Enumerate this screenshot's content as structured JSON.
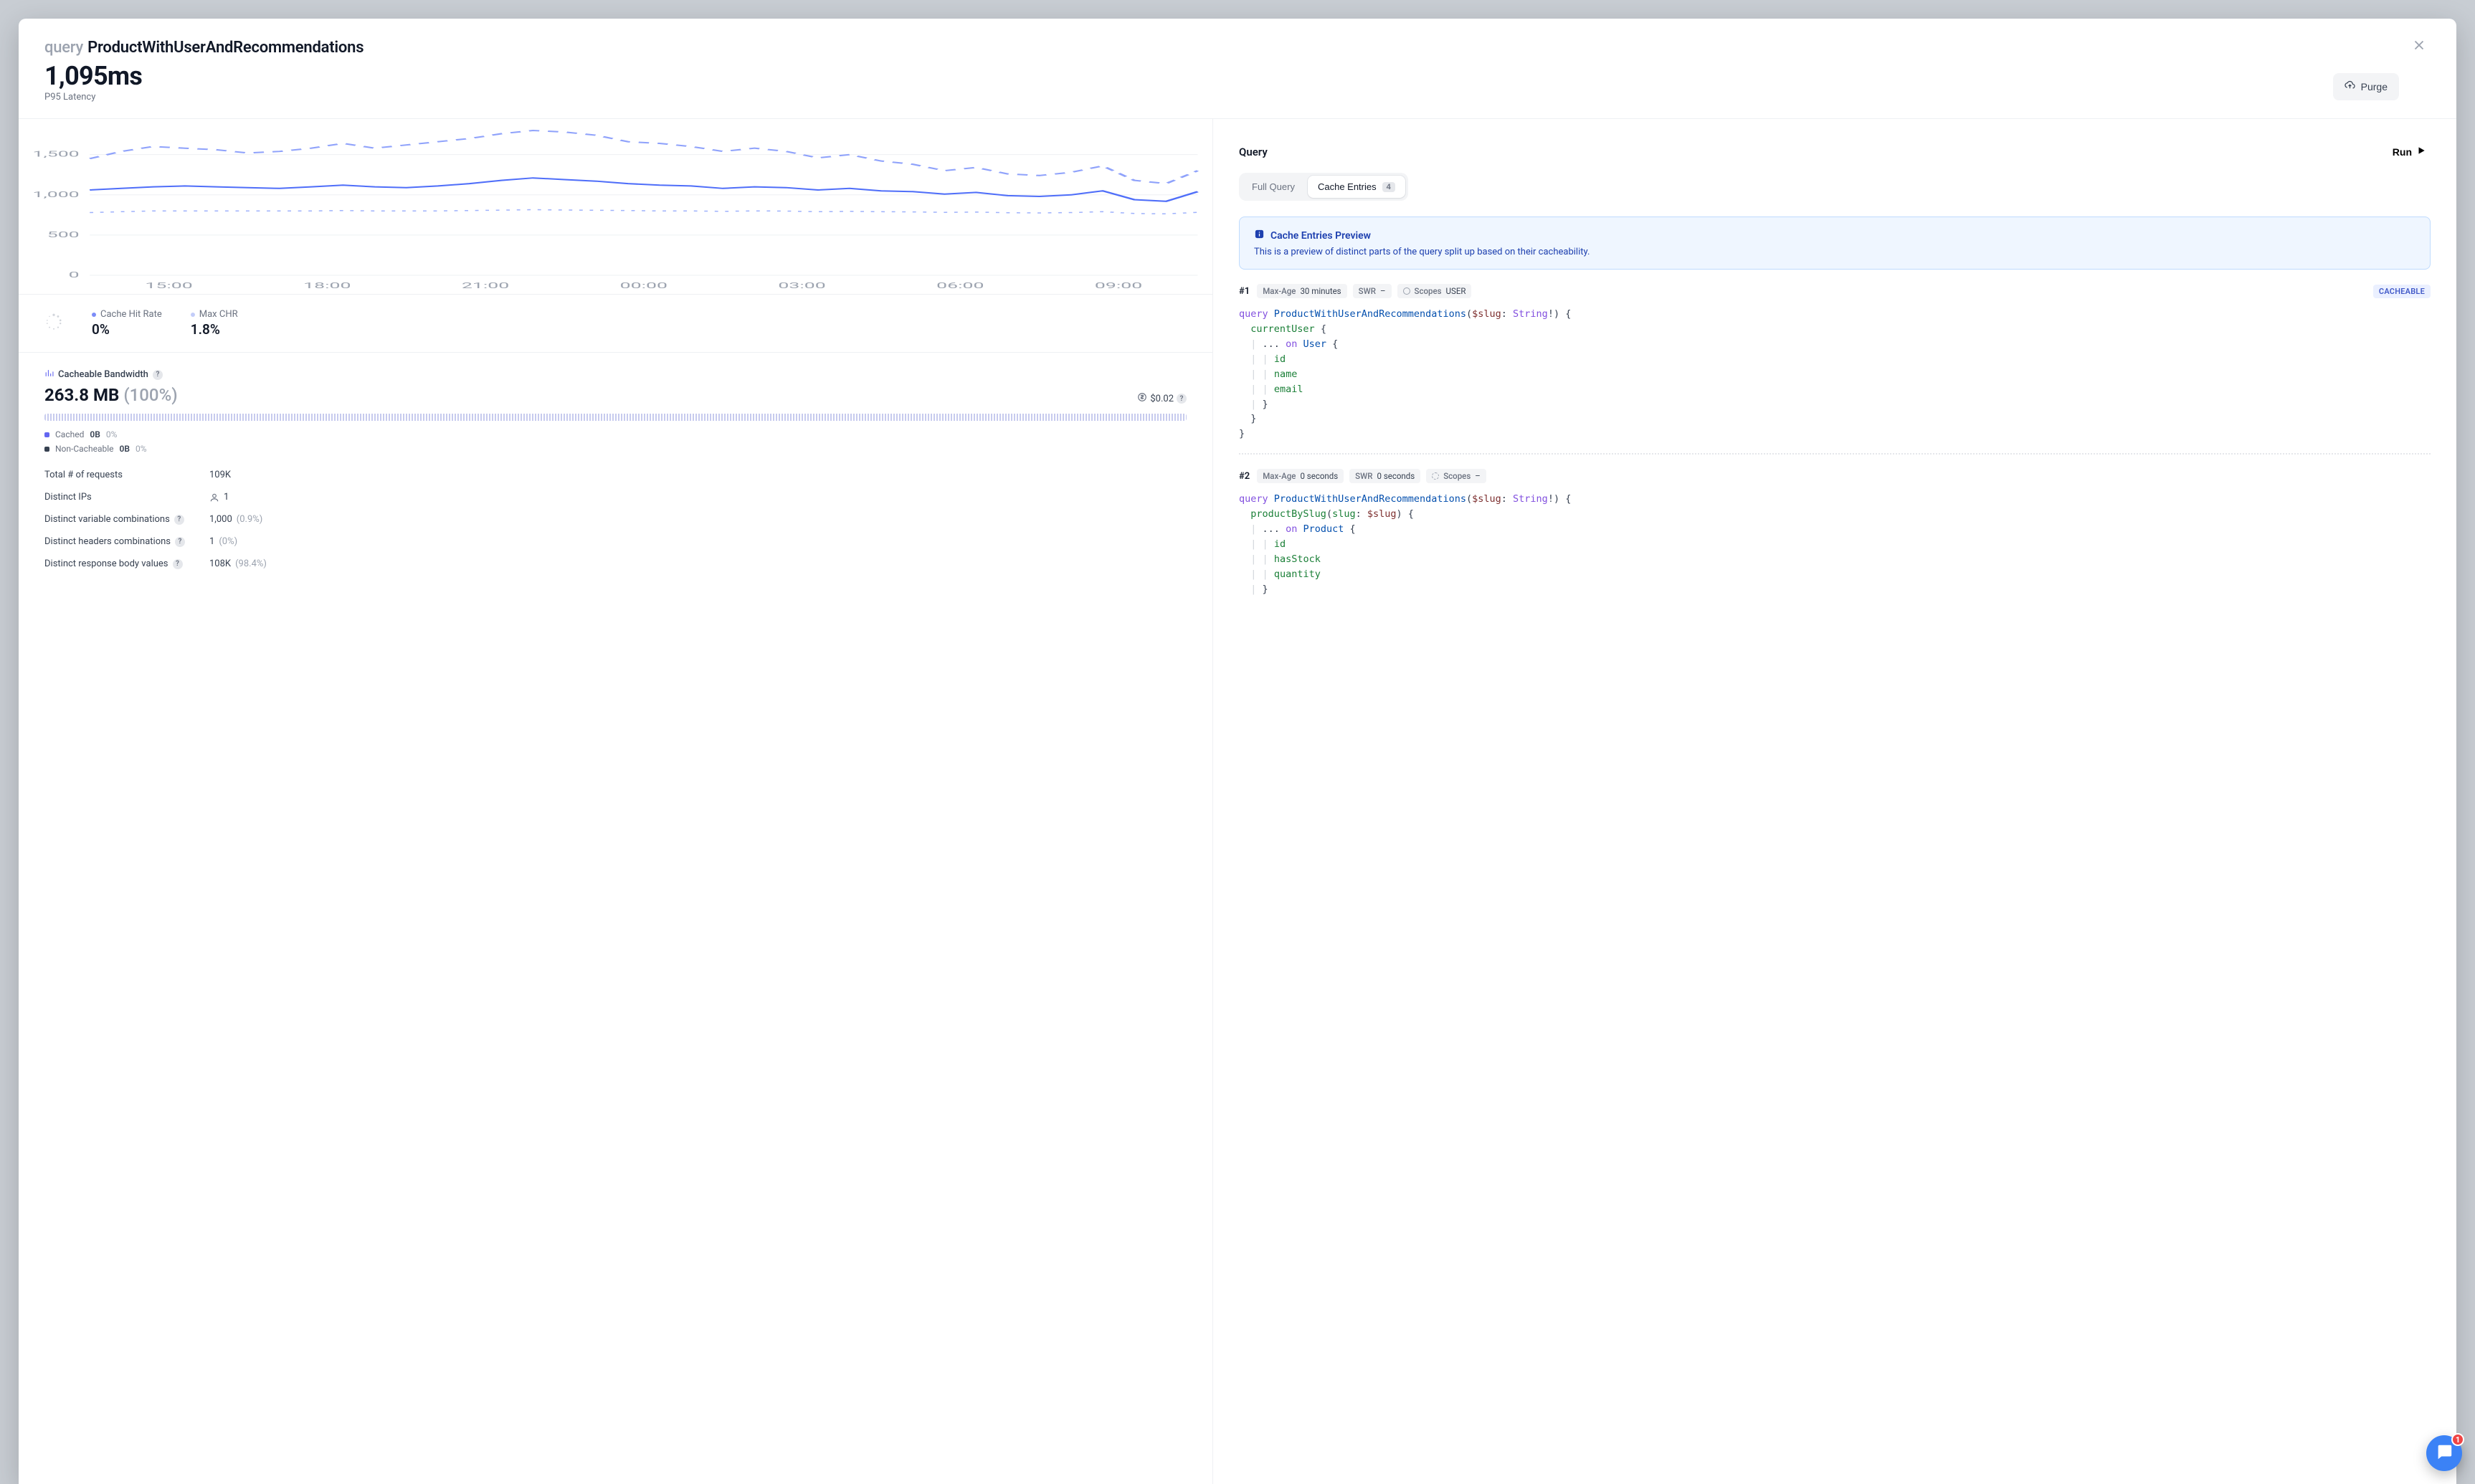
{
  "header": {
    "kind": "query",
    "name": "ProductWithUserAndRecommendations",
    "metric_value": "1,095ms",
    "metric_label": "P95 Latency",
    "purge_label": "Purge"
  },
  "chart_data": {
    "type": "line",
    "xlabel": "",
    "ylabel": "",
    "ylim": [
      0,
      1800
    ],
    "x_ticks": [
      "15:00",
      "18:00",
      "21:00",
      "00:00",
      "03:00",
      "06:00",
      "09:00"
    ],
    "y_ticks": [
      0,
      500,
      1000,
      1500
    ],
    "series": [
      {
        "name": "upper",
        "style": "dashed",
        "values": [
          1450,
          1540,
          1600,
          1580,
          1560,
          1520,
          1540,
          1580,
          1640,
          1580,
          1620,
          1660,
          1700,
          1760,
          1800,
          1780,
          1740,
          1660,
          1640,
          1600,
          1540,
          1580,
          1540,
          1460,
          1500,
          1420,
          1380,
          1300,
          1340,
          1260,
          1240,
          1280,
          1360,
          1180,
          1140,
          1300
        ]
      },
      {
        "name": "mid",
        "style": "solid",
        "values": [
          1060,
          1080,
          1100,
          1110,
          1100,
          1090,
          1080,
          1100,
          1120,
          1100,
          1090,
          1110,
          1140,
          1180,
          1210,
          1190,
          1170,
          1140,
          1120,
          1110,
          1080,
          1100,
          1090,
          1060,
          1080,
          1050,
          1040,
          1010,
          1030,
          990,
          980,
          1000,
          1050,
          940,
          920,
          1040
        ]
      },
      {
        "name": "lower",
        "style": "dotted",
        "values": [
          780,
          790,
          800,
          800,
          800,
          800,
          800,
          800,
          805,
          800,
          800,
          800,
          805,
          810,
          815,
          812,
          808,
          805,
          800,
          800,
          795,
          800,
          798,
          790,
          795,
          790,
          788,
          782,
          786,
          778,
          775,
          780,
          790,
          768,
          764,
          782
        ]
      }
    ]
  },
  "metrics": {
    "cache_hit_rate": {
      "label": "Cache Hit Rate",
      "value": "0%"
    },
    "max_chr": {
      "label": "Max CHR",
      "value": "1.8%"
    }
  },
  "bandwidth": {
    "label": "Cacheable Bandwidth",
    "value": "263.8 MB",
    "pct": "(100%)",
    "cost_label": "$0.02",
    "legend": {
      "cached": {
        "label": "Cached",
        "value": "0B",
        "pct": "0%"
      },
      "non_cacheable": {
        "label": "Non-Cacheable",
        "value": "0B",
        "pct": "0%"
      }
    }
  },
  "stats": [
    {
      "label": "Total # of requests",
      "value": "109K",
      "help": false,
      "icon": null
    },
    {
      "label": "Distinct IPs",
      "value": "1",
      "help": false,
      "icon": "person"
    },
    {
      "label": "Distinct variable combinations",
      "value": "1,000",
      "sub": "(0.9%)",
      "help": true
    },
    {
      "label": "Distinct headers combinations",
      "value": "1",
      "sub": "(0%)",
      "help": true
    },
    {
      "label": "Distinct response body values",
      "value": "108K",
      "sub": "(98.4%)",
      "help": true
    }
  ],
  "query_panel": {
    "title": "Query",
    "run_label": "Run",
    "tabs": {
      "full_query": "Full Query",
      "cache_entries": {
        "label": "Cache Entries",
        "count": "4"
      }
    },
    "notice": {
      "title": "Cache Entries Preview",
      "body": "This is a preview of distinct parts of the query split up based on their cacheability."
    }
  },
  "entries": [
    {
      "id": "#1",
      "max_age": {
        "k": "Max-Age",
        "v": "30 minutes"
      },
      "swr": {
        "k": "SWR",
        "v": "–"
      },
      "scopes": {
        "k": "Scopes",
        "v": "USER",
        "dashed": false
      },
      "badge": "CACHEABLE",
      "code_html": "<span class=\"kw\">query</span> <span class=\"name\">ProductWithUserAndRecommendations</span><span class=\"punct\">(</span><span class=\"var\">$slug</span><span class=\"punct\">: </span><span class=\"type\">String</span><span class=\"punct\">!) {</span>\n  <span class=\"field\">currentUser</span> <span class=\"punct\">{</span>\n  <span class=\"guide\">|</span> <span class=\"punct\">...</span> <span class=\"kw\">on</span> <span class=\"name\">User</span> <span class=\"punct\">{</span>\n  <span class=\"guide\">|</span> <span class=\"guide\">|</span> <span class=\"field\">id</span>\n  <span class=\"guide\">|</span> <span class=\"guide\">|</span> <span class=\"field\">name</span>\n  <span class=\"guide\">|</span> <span class=\"guide\">|</span> <span class=\"field\">email</span>\n  <span class=\"guide\">|</span> <span class=\"punct\">}</span>\n  <span class=\"punct\">}</span>\n<span class=\"punct\">}</span>"
    },
    {
      "id": "#2",
      "max_age": {
        "k": "Max-Age",
        "v": "0 seconds"
      },
      "swr": {
        "k": "SWR",
        "v": "0 seconds"
      },
      "scopes": {
        "k": "Scopes",
        "v": "–",
        "dashed": true
      },
      "badge": null,
      "code_html": "<span class=\"kw\">query</span> <span class=\"name\">ProductWithUserAndRecommendations</span><span class=\"punct\">(</span><span class=\"var\">$slug</span><span class=\"punct\">: </span><span class=\"type\">String</span><span class=\"punct\">!) {</span>\n  <span class=\"field\">productBySlug</span><span class=\"punct\">(</span><span class=\"field\">slug</span><span class=\"punct\">: </span><span class=\"var\">$slug</span><span class=\"punct\">) {</span>\n  <span class=\"guide\">|</span> <span class=\"punct\">...</span> <span class=\"kw\">on</span> <span class=\"name\">Product</span> <span class=\"punct\">{</span>\n  <span class=\"guide\">|</span> <span class=\"guide\">|</span> <span class=\"field\">id</span>\n  <span class=\"guide\">|</span> <span class=\"guide\">|</span> <span class=\"field\">hasStock</span>\n  <span class=\"guide\">|</span> <span class=\"guide\">|</span> <span class=\"field\">quantity</span>\n  <span class=\"guide\">|</span> <span class=\"punct\">}</span>"
    }
  ],
  "intercom": {
    "badge": "1"
  }
}
